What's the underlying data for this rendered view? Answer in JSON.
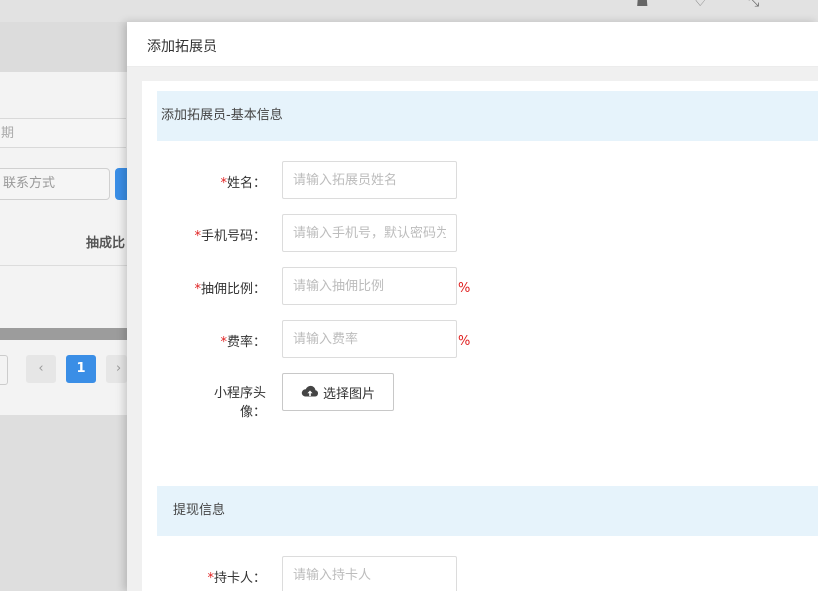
{
  "background": {
    "search_placeholder_1": "期",
    "search_placeholder_2": "联系方式",
    "table_header": "抽成比",
    "pagination": {
      "prev": "‹",
      "current": "1",
      "next": "›"
    }
  },
  "drawer": {
    "title": "添加拓展员",
    "section_basic": {
      "title": "添加拓展员-基本信息"
    },
    "fields": {
      "name": {
        "required_mark": "*",
        "label": "姓名：",
        "placeholder": "请输入拓展员姓名",
        "value": ""
      },
      "phone": {
        "required_mark": "*",
        "label": "手机号码：",
        "placeholder": "请输入手机号，默认密码为",
        "value": ""
      },
      "commission": {
        "required_mark": "*",
        "label": "抽佣比例：",
        "placeholder": "请输入抽佣比例",
        "value": "",
        "suffix": "%"
      },
      "rate": {
        "required_mark": "*",
        "label": "费率：",
        "placeholder": "请输入费率",
        "value": "",
        "suffix": "%"
      },
      "avatar": {
        "label": "小程序头像：",
        "button_label": "选择图片"
      }
    },
    "section_withdraw": {
      "title": "提现信息"
    },
    "withdraw_fields": {
      "cardholder": {
        "required_mark": "*",
        "label": "持卡人：",
        "placeholder": "请输入持卡人",
        "value": ""
      }
    }
  },
  "colors": {
    "required": "#e02020",
    "section_bg": "#e6f3fb",
    "primary": "#3a8ee6"
  }
}
